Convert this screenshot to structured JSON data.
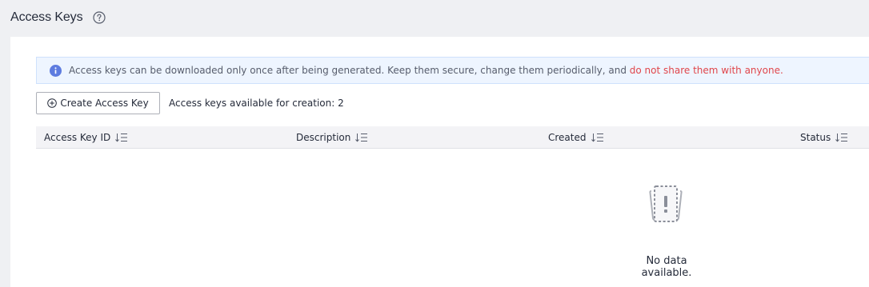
{
  "header": {
    "title": "Access Keys",
    "help_icon": "question-circle-icon"
  },
  "notice": {
    "icon": "info-circle-icon",
    "text": "Access keys can be downloaded only once after being generated. Keep them secure, change them periodically, and ",
    "warning": "do not share them with anyone.",
    "colors": {
      "background": "#eef5ff",
      "warning": "#e0464b",
      "icon": "#5e7ce0"
    }
  },
  "toolbar": {
    "create_button_label": "Create Access Key",
    "create_button_icon": "plus-circle-icon",
    "quota_text": "Access keys available for creation: 2"
  },
  "table": {
    "columns": [
      {
        "label": "Access Key ID",
        "icon": "sort-icon"
      },
      {
        "label": "Description",
        "icon": "sort-icon"
      },
      {
        "label": "Created",
        "icon": "sort-icon"
      },
      {
        "label": "Status",
        "icon": "sort-icon"
      }
    ],
    "rows": [],
    "empty": {
      "icon": "empty-warning-icon",
      "text": "No data available."
    }
  }
}
